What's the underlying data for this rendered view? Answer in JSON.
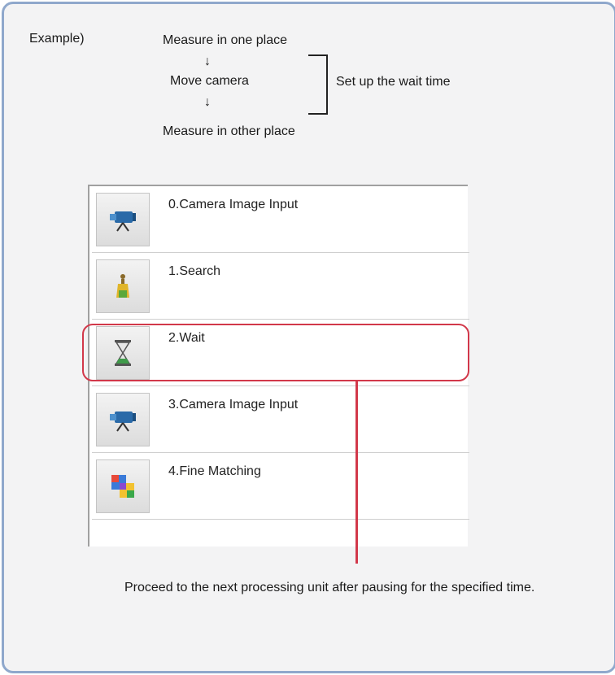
{
  "example_label": "Example)",
  "flow": {
    "step1": "Measure in one place",
    "arrow1": "↓",
    "step2": "Move camera",
    "arrow2": "↓",
    "step3": "Measure in other place",
    "bracket_label": "Set up the wait time"
  },
  "units": [
    {
      "label": "0.Camera Image Input",
      "icon": "camera-icon"
    },
    {
      "label": "1.Search",
      "icon": "search-icon"
    },
    {
      "label": "2.Wait",
      "icon": "hourglass-icon"
    },
    {
      "label": "3.Camera Image Input",
      "icon": "camera-icon"
    },
    {
      "label": "4.Fine Matching",
      "icon": "fine-matching-icon"
    }
  ],
  "highlight_color": "#d2384a",
  "note": "Proceed to the next processing unit after pausing for the specified time."
}
